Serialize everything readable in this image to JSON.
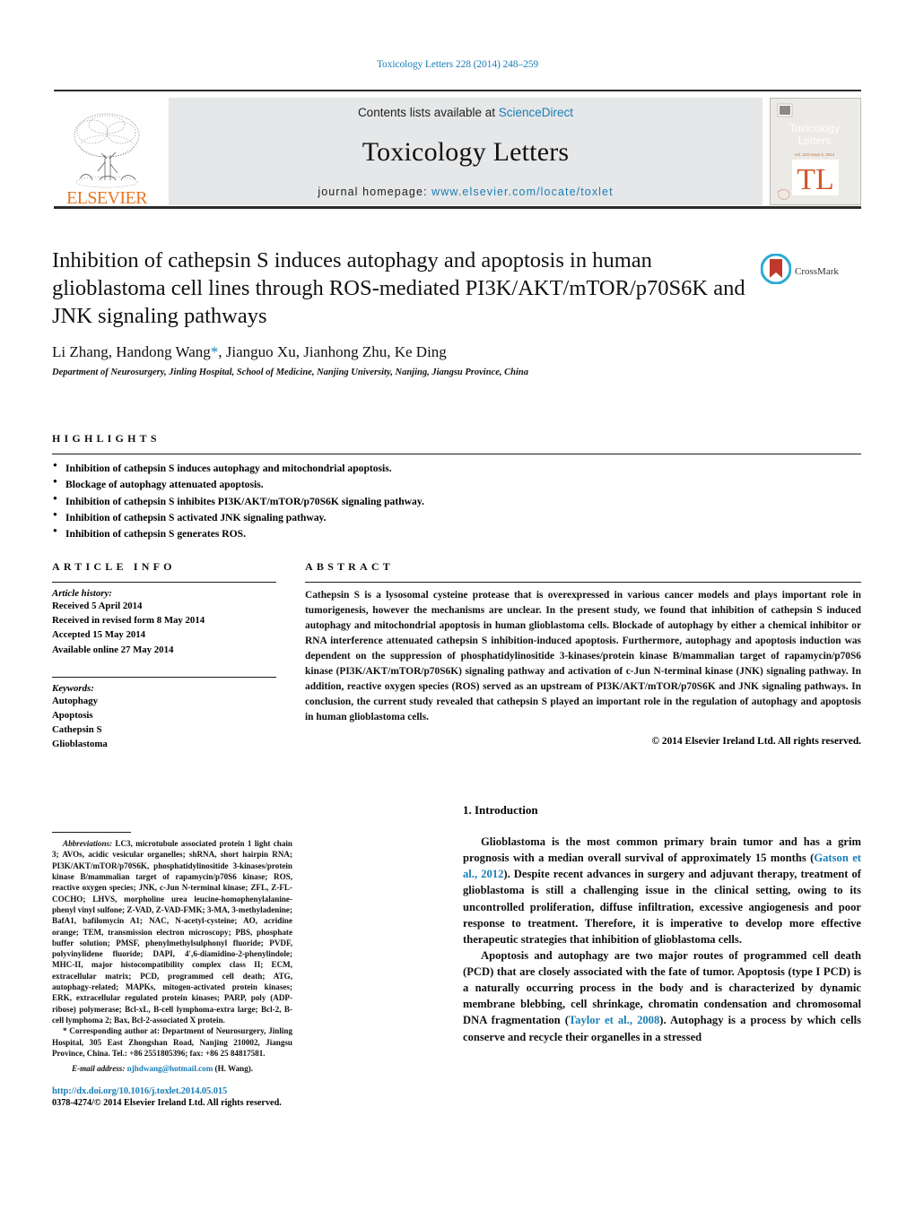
{
  "running_head": "Toxicology Letters 228 (2014) 248–259",
  "masthead": {
    "publisher": "ELSEVIER",
    "contents_prefix": "Contents lists available at ",
    "contents_link": "ScienceDirect",
    "journal_title": "Toxicology Letters",
    "homepage_prefix": "journal homepage: ",
    "homepage_link": "www.elsevier.com/locate/toxlet",
    "cover_title_line1": "Toxicology",
    "cover_title_line2": "Letters",
    "cover_mark": "TL"
  },
  "article": {
    "title": "Inhibition of cathepsin S induces autophagy and apoptosis in human glioblastoma cell lines through ROS-mediated PI3K/AKT/mTOR/p70S6K and JNK signaling pathways",
    "authors_before_star": "Li Zhang, Handong Wang",
    "author_star": "*",
    "authors_after_star": ", Jianguo Xu, Jianhong Zhu, Ke Ding",
    "affiliation": "Department of Neurosurgery, Jinling Hospital, School of Medicine, Nanjing University, Nanjing, Jiangsu Province, China",
    "crossmark_label": "CrossMark"
  },
  "highlights": {
    "heading": "HIGHLIGHTS",
    "items": [
      "Inhibition of cathepsin S induces autophagy and mitochondrial apoptosis.",
      "Blockage of autophagy attenuated apoptosis.",
      "Inhibition of cathepsin S inhibites PI3K/AKT/mTOR/p70S6K signaling pathway.",
      "Inhibition of cathepsin S activated JNK signaling pathway.",
      "Inhibition of cathepsin S generates ROS."
    ]
  },
  "article_info": {
    "heading": "ARTICLE INFO",
    "history_label": "Article history:",
    "history": [
      "Received 5 April 2014",
      "Received in revised form 8 May 2014",
      "Accepted 15 May 2014",
      "Available online 27 May 2014"
    ],
    "keywords_label": "Keywords:",
    "keywords": [
      "Autophagy",
      "Apoptosis",
      "Cathepsin S",
      "Glioblastoma"
    ]
  },
  "abstract": {
    "heading": "ABSTRACT",
    "body": "Cathepsin S is a lysosomal cysteine protease that is overexpressed in various cancer models and plays important role in tumorigenesis, however the mechanisms are unclear. In the present study, we found that inhibition of cathepsin S induced autophagy and mitochondrial apoptosis in human glioblastoma cells. Blockade of autophagy by either a chemical inhibitor or RNA interference attenuated cathepsin S inhibition-induced apoptosis. Furthermore, autophagy and apoptosis induction was dependent on the suppression of phosphatidylinositide 3-kinases/protein kinase B/mammalian target of rapamycin/p70S6 kinase (PI3K/AKT/mTOR/p70S6K) signaling pathway and activation of c-Jun N-terminal kinase (JNK) signaling pathway. In addition, reactive oxygen species (ROS) served as an upstream of PI3K/AKT/mTOR/p70S6K and JNK signaling pathways. In conclusion, the current study revealed that cathepsin S played an important role in the regulation of autophagy and apoptosis in human glioblastoma cells.",
    "copyright": "© 2014 Elsevier Ireland Ltd. All rights reserved."
  },
  "introduction": {
    "heading": "1. Introduction",
    "p1_a": "Glioblastoma is the most common primary brain tumor and has a grim prognosis with a median overall survival of approximately 15 months (",
    "p1_ref": "Gatson et al., 2012",
    "p1_b": "). Despite recent advances in surgery and adjuvant therapy, treatment of glioblastoma is still a challenging issue in the clinical setting, owing to its uncontrolled proliferation, diffuse infiltration, excessive angiogenesis and poor response to treatment. Therefore, it is imperative to develop more effective therapeutic strategies that inhibition of glioblastoma cells.",
    "p2_a": "Apoptosis and autophagy are two major routes of programmed cell death (PCD) that are closely associated with the fate of tumor. Apoptosis (type I PCD) is a naturally occurring process in the body and is characterized by dynamic membrane blebbing, cell shrinkage, chromatin condensation and chromosomal DNA fragmentation (",
    "p2_ref": "Taylor et al., 2008",
    "p2_b": "). Autophagy is a process by which cells conserve and recycle their organelles in a stressed"
  },
  "footnote": {
    "abbrev_label": "Abbreviations:",
    "abbrev_text": " LC3, microtubule associated protein 1 light chain 3; AVOs, acidic vesicular organelles; shRNA, short hairpin RNA; PI3K/AKT/mTOR/p70S6K, phosphatidylinositide 3-kinases/protein kinase B/mammalian target of rapamycin/p70S6 kinase; ROS, reactive oxygen species; JNK, c-Jun N-terminal kinase; ZFL, Z-FL-COCHO; LHVS, morpholine urea leucine-homophenylalanine-phenyl vinyl sulfone; Z-VAD, Z-VAD-FMK; 3-MA, 3-methyladenine; BafA1, bafilomycin A1; NAC, N-acetyl-cysteine; AO, acridine orange; TEM, transmission electron microscopy; PBS, phosphate buffer solution; PMSF, phenylmethylsulphonyl fluoride; PVDF, polyvinylidene fluoride; DAPI, 4′,6-diamidino-2-phenylindole; MHC-II, major histocompatibility complex class II; ECM, extracellular matrix; PCD, programmed cell death; ATG, autophagy-related; MAPKs, mitogen-activated protein kinases; ERK, extracellular regulated protein kinases; PARP, poly (ADP-ribose) polymerase; Bcl-xL, B-cell lymphoma-extra large; Bcl-2, B-cell lymphoma 2; Bax, Bcl-2-associated X protein.",
    "corr_star": "*",
    "corr_text": " Corresponding author at: Department of Neurosurgery, Jinling Hospital, 305 East Zhongshan Road, Nanjing 210002, Jiangsu Province, China. Tel.: +86 2551805396; fax: +86 25 84817581.",
    "email_label": "E-mail address:",
    "email_link": "njhdwang@hotmail.com",
    "email_suffix": " (H. Wang).",
    "doi": "http://dx.doi.org/10.1016/j.toxlet.2014.05.015",
    "issn": "0378-4274/© 2014 Elsevier Ireland Ltd. All rights reserved."
  },
  "colors": {
    "link": "#1a7eb5",
    "elsevier_orange": "#E87722",
    "masthead_bg": "#e6e7e8"
  }
}
